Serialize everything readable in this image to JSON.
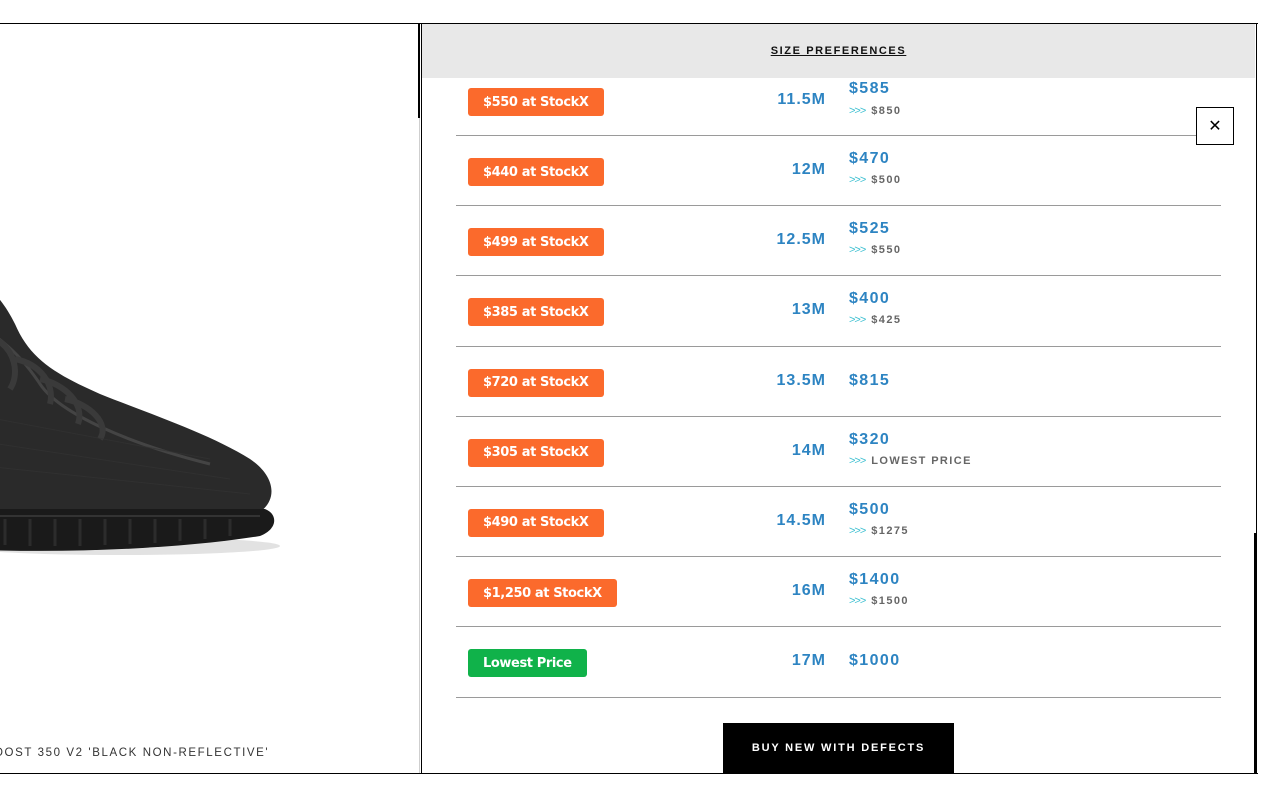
{
  "product": {
    "title": "OOST 350 V2 'BLACK NON-REFLECTIVE'"
  },
  "modal": {
    "header": "SIZE PREFERENCES",
    "close_icon": "close-icon",
    "rows": [
      {
        "badge": "$550 at StockX",
        "badge_type": "orange",
        "size": "11.5M",
        "price": "$585",
        "sub": "$850"
      },
      {
        "badge": "$440 at StockX",
        "badge_type": "orange",
        "size": "12M",
        "price": "$470",
        "sub": "$500"
      },
      {
        "badge": "$499 at StockX",
        "badge_type": "orange",
        "size": "12.5M",
        "price": "$525",
        "sub": "$550"
      },
      {
        "badge": "$385 at StockX",
        "badge_type": "orange",
        "size": "13M",
        "price": "$400",
        "sub": "$425"
      },
      {
        "badge": "$720 at StockX",
        "badge_type": "orange",
        "size": "13.5M",
        "price": "$815",
        "sub": ""
      },
      {
        "badge": "$305 at StockX",
        "badge_type": "orange",
        "size": "14M",
        "price": "$320",
        "sub": "LOWEST PRICE"
      },
      {
        "badge": "$490 at StockX",
        "badge_type": "orange",
        "size": "14.5M",
        "price": "$500",
        "sub": "$1275"
      },
      {
        "badge": "$1,250 at StockX",
        "badge_type": "orange",
        "size": "16M",
        "price": "$1400",
        "sub": "$1500"
      },
      {
        "badge": "Lowest Price",
        "badge_type": "green",
        "size": "17M",
        "price": "$1000",
        "sub": ""
      }
    ],
    "buy_button": "BUY NEW WITH DEFECTS",
    "chevrons": ">>>"
  },
  "colors": {
    "accent_blue": "#2d84c2",
    "stockx_orange": "#fb6a2c",
    "lowest_green": "#10b24a"
  }
}
